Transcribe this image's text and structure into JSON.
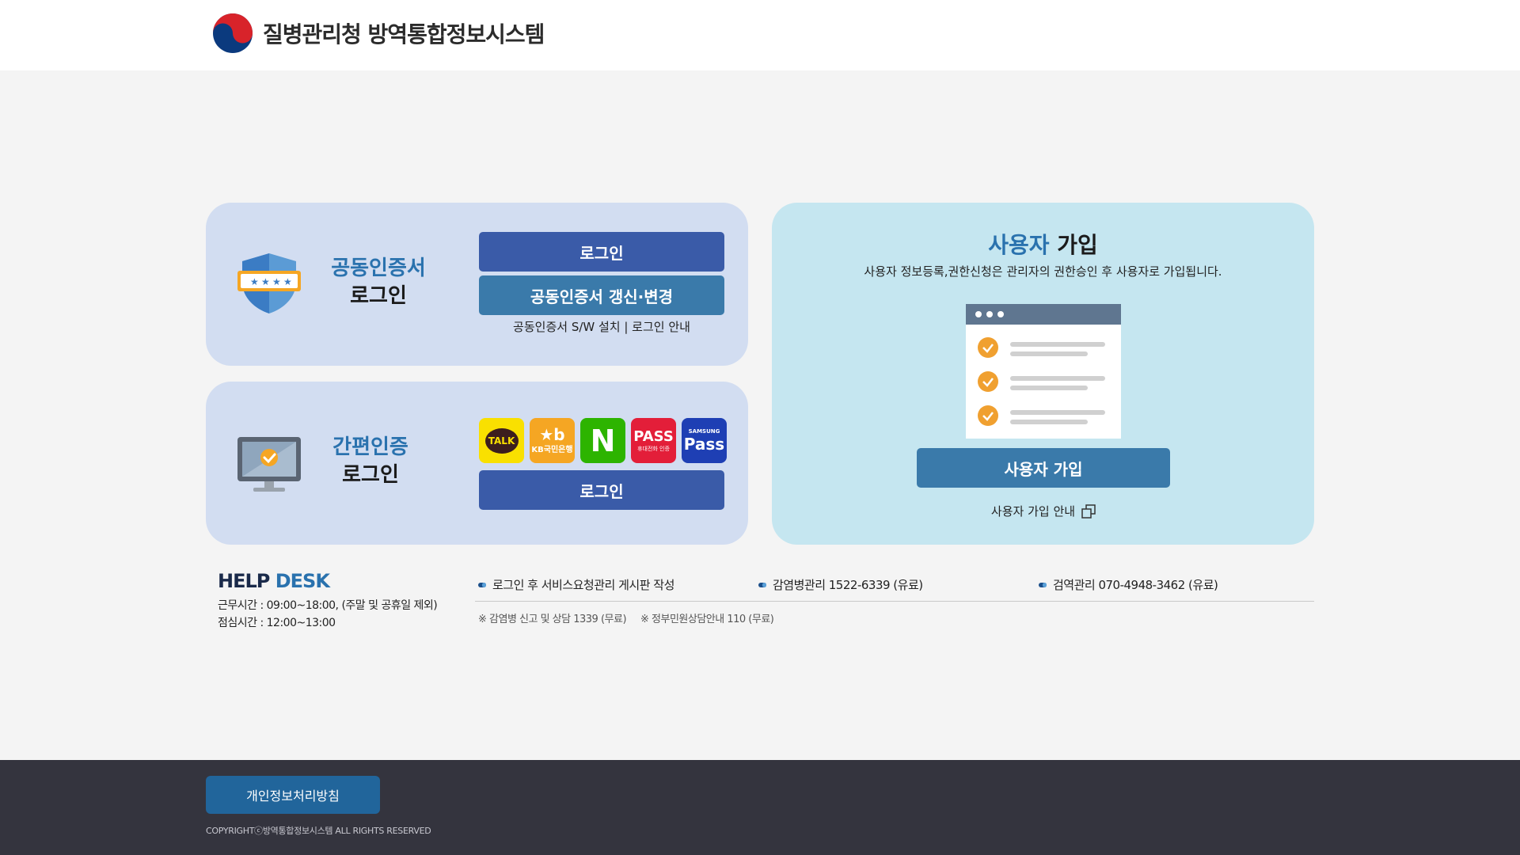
{
  "header": {
    "title": "질병관리청 방역통합정보시스템",
    "logo_icon": "taegeuk-logo-icon"
  },
  "cert_login": {
    "heading_blue": "공동인증서",
    "heading_dark": "로그인",
    "icon": "shield-icon",
    "login_button": "로그인",
    "renew_button": "공동인증서 갱신·변경",
    "guide_link": "공동인증서 S/W 설치 | 로그인 안내"
  },
  "simple_login": {
    "heading_blue": "간편인증",
    "heading_dark": "로그인",
    "icon": "monitor-check-icon",
    "providers": {
      "kakao": "TALK",
      "kb_logo": "★b",
      "kb_name": "KB국민은행",
      "naver": "N",
      "pass": "PASS",
      "pass_sub": "휴대전화 인증",
      "samsung_small": "SAMSUNG",
      "samsung": "Pass"
    },
    "login_button": "로그인"
  },
  "join": {
    "title_blue": "사용자",
    "title_dark": "가입",
    "description": "사용자 정보등록,권한신청은 관리자의 권한승인 후 사용자로 가입됩니다.",
    "join_button": "사용자 가입",
    "guide_link": "사용자 가입 안내"
  },
  "helpdesk": {
    "title_dark": "HELP",
    "title_blue": "DESK",
    "hours": "근무시간 : 09:00~18:00, (주말 및 공휴일 제외)",
    "lunch": "점심시간 : 12:00~13:00",
    "contacts": [
      "로그인 후 서비스요청관리 게시판 작성",
      "감염병관리 1522-6339 (유료)",
      "검역관리 070-4948-3462 (유료)"
    ],
    "notes": [
      "※ 감염병 신고 및 상담 1339 (무료)",
      "※ 정부민원상담안내 110 (무료)"
    ]
  },
  "footer": {
    "privacy_button": "개인정보처리방침",
    "copyright": "COPYRIGHTⓒ방역통합정보시스템 ALL RIGHTS RESERVED"
  },
  "colors": {
    "panel_lavender": "#d2ddf1",
    "panel_sky": "#c5e6f0",
    "button_navy": "#3a5ba8",
    "button_steel": "#3a7aaa",
    "footer_bg": "#34343e",
    "accent_blue": "#2a72ae"
  }
}
